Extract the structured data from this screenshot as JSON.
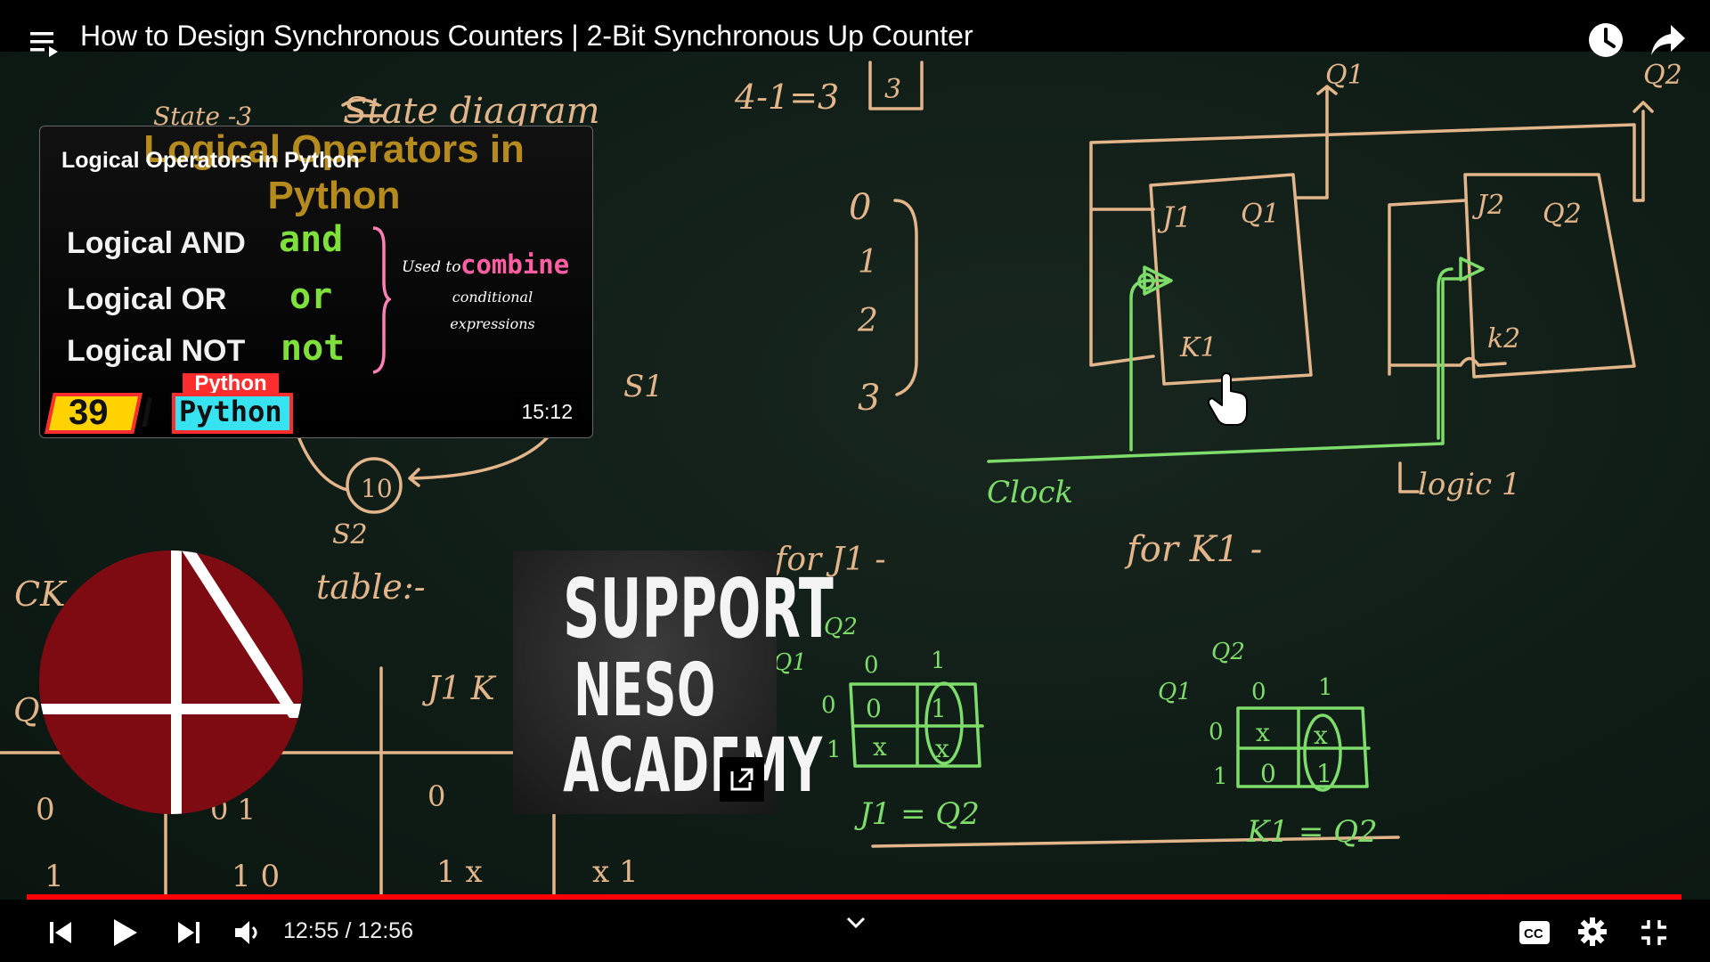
{
  "video": {
    "title": "How to Design Synchronous Counters | 2-Bit Synchronous Up Counter",
    "current_time": "12:55",
    "separator": " / ",
    "duration": "12:56",
    "progress": 0.9987
  },
  "end_card": {
    "ghost_title": "Logical Operators in Python",
    "title": "Logical Operators in Python",
    "rows": [
      {
        "label": "Logical AND",
        "keyword": "and"
      },
      {
        "label": "Logical OR",
        "keyword": "or"
      },
      {
        "label": "Logical NOT",
        "keyword": "not"
      }
    ],
    "used_to": "Used to",
    "combine": "combine",
    "desc_line1": "conditional",
    "desc_line2": "expressions",
    "badge_number": "39",
    "badge_slash": "/",
    "badge_lang": "Python",
    "badge_top": "Python",
    "duration": "15:12"
  },
  "support_card": {
    "line1": "SUPPORT",
    "line2": "NESO",
    "line3": "ACADEMY"
  },
  "colors": {
    "progress": "#ff0000",
    "chalk_orange": "#e3b58a",
    "chalk_green": "#7ddc6a",
    "logo_red": "#7e0a12"
  },
  "icons": [
    "playlist-icon",
    "watch-later-icon",
    "share-icon",
    "previous-icon",
    "play-icon",
    "next-icon",
    "volume-icon",
    "chevron-down-icon",
    "captions-icon",
    "settings-icon",
    "exit-fullscreen-icon",
    "external-link-icon"
  ]
}
